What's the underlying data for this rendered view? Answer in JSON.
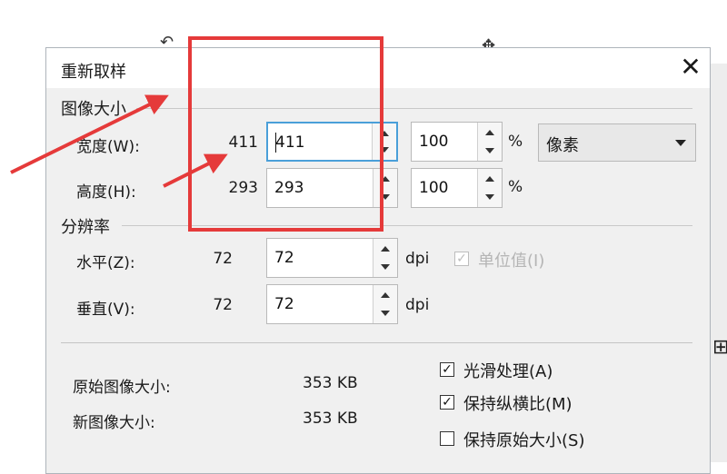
{
  "dialog": {
    "title": "重新取样",
    "close_glyph": "✕"
  },
  "image_size": {
    "group_label": "图像大小",
    "width": {
      "label": "宽度(W):",
      "original": "411",
      "value": "411",
      "percent": "100",
      "percent_unit": "%"
    },
    "height": {
      "label": "高度(H):",
      "original": "293",
      "value": "293",
      "percent": "100",
      "percent_unit": "%"
    },
    "unit_select": {
      "value": "像素"
    }
  },
  "resolution": {
    "group_label": "分辨率",
    "horizontal": {
      "label": "水平(Z):",
      "original": "72",
      "value": "72",
      "unit": "dpi"
    },
    "vertical": {
      "label": "垂直(V):",
      "original": "72",
      "value": "72",
      "unit": "dpi"
    },
    "unit_value_checkbox": {
      "label": "单位值(I)",
      "checked": true,
      "enabled": false
    }
  },
  "sizes": {
    "original": {
      "label": "原始图像大小:",
      "value": "353 KB"
    },
    "new": {
      "label": "新图像大小:",
      "value": "353 KB"
    }
  },
  "options": {
    "smooth": {
      "label": "光滑处理(A)",
      "checked": true
    },
    "keep_ratio": {
      "label": "保持纵横比(M)",
      "checked": true
    },
    "keep_original": {
      "label": "保持原始大小(S)",
      "checked": false
    }
  },
  "annotation": {
    "color": "#e53a3a"
  }
}
